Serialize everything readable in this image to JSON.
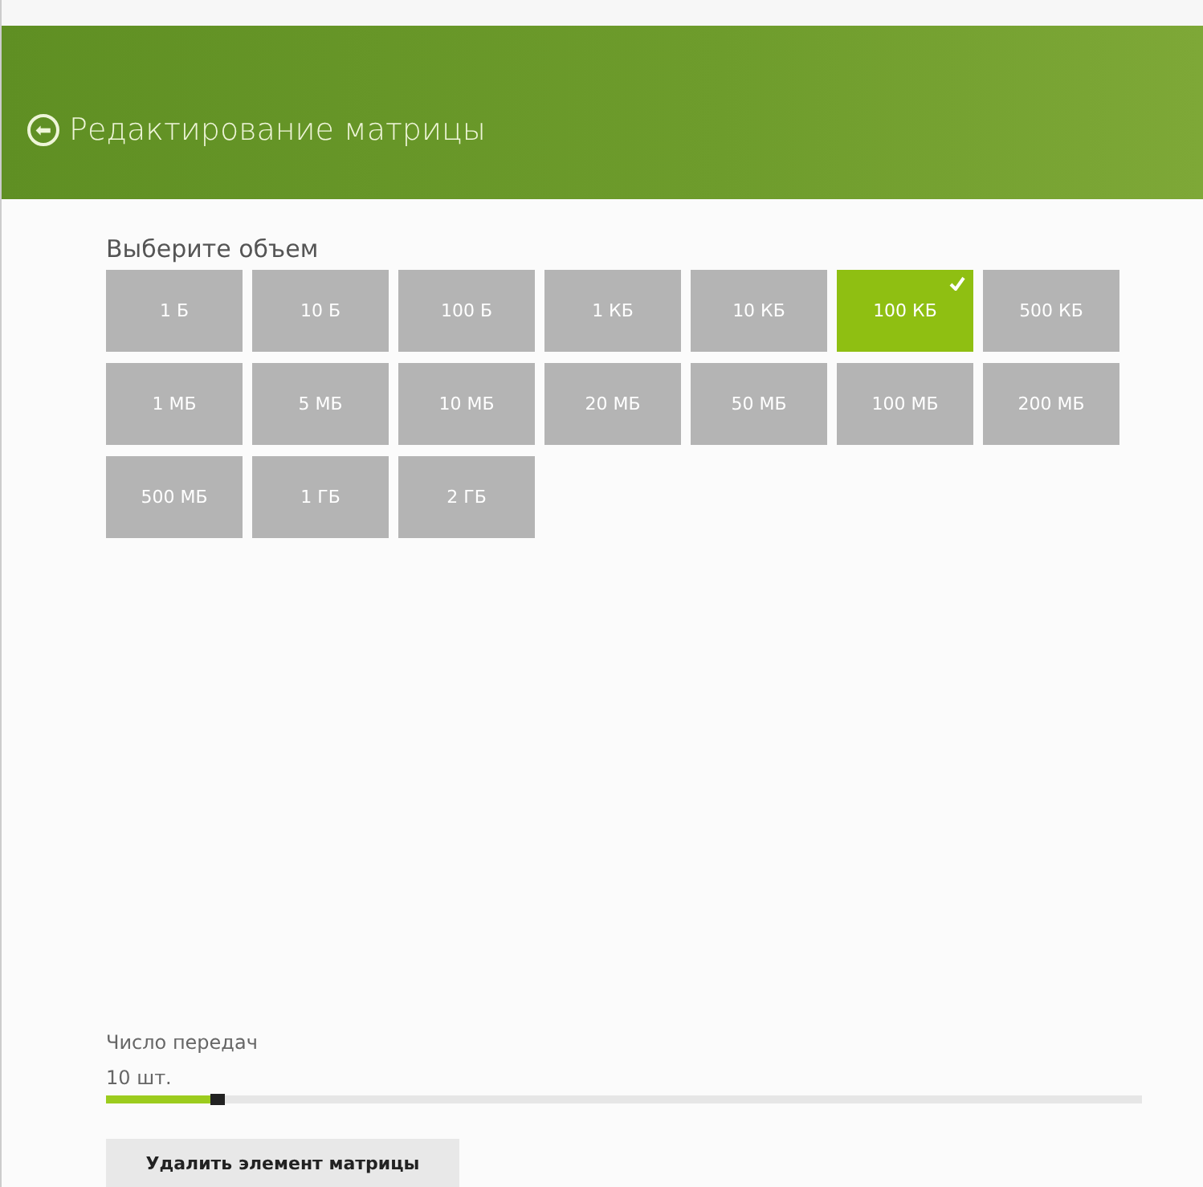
{
  "header": {
    "back": "⬅",
    "title": "Редактирование матрицы"
  },
  "size_picker": {
    "label": "Выберите объем",
    "options": [
      {
        "label": "1 Б",
        "selected": false
      },
      {
        "label": "10 Б",
        "selected": false
      },
      {
        "label": "100 Б",
        "selected": false
      },
      {
        "label": "1 КБ",
        "selected": false
      },
      {
        "label": "10 КБ",
        "selected": false
      },
      {
        "label": "100 КБ",
        "selected": true
      },
      {
        "label": "500 КБ",
        "selected": false
      },
      {
        "label": "1 МБ",
        "selected": false
      },
      {
        "label": "5 МБ",
        "selected": false
      },
      {
        "label": "10 МБ",
        "selected": false
      },
      {
        "label": "20 МБ",
        "selected": false
      },
      {
        "label": "50 МБ",
        "selected": false
      },
      {
        "label": "100 МБ",
        "selected": false
      },
      {
        "label": "200 МБ",
        "selected": false
      },
      {
        "label": "500 МБ",
        "selected": false
      },
      {
        "label": "1 ГБ",
        "selected": false
      },
      {
        "label": "2 ГБ",
        "selected": false
      }
    ]
  },
  "transfers": {
    "label": "Число передач",
    "reading": "10 шт.",
    "level": 0.1
  },
  "delete_button": "Удалить элемент матрицы"
}
